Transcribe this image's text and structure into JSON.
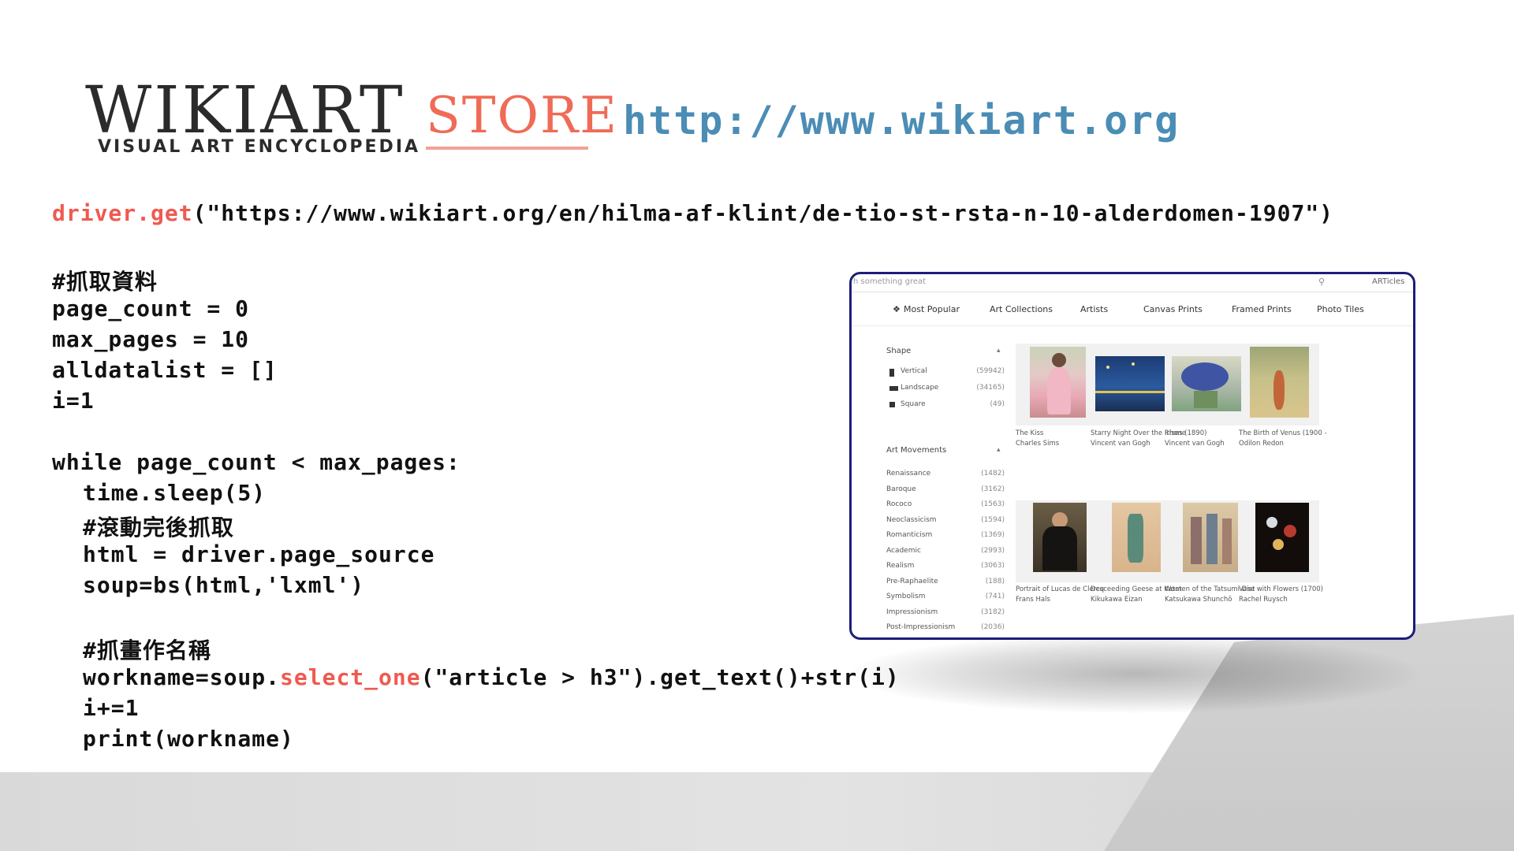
{
  "header": {
    "logo_main": "WIKIART",
    "logo_sub": "VISUAL ART ENCYCLOPEDIA",
    "logo_store": "STORE",
    "url": "http://www.wikiart.org"
  },
  "code": {
    "line1_fn": "driver.get",
    "line1_arg": "(\"https://www.wikiart.org/en/hilma-af-klint/de-tio-st-rsta-n-10-alderdomen-1907\")",
    "c1": "#抓取資料",
    "l2": "page_count = 0",
    "l3": "max_pages = 10",
    "l4": "alldatalist = []",
    "l5": "i=1",
    "l6": "while page_count < max_pages:",
    "l7": "time.sleep(5)",
    "c2": "#滾動完後抓取",
    "l8": "html = driver.page_source",
    "l9": "soup=bs(html,'lxml')",
    "c3": "#抓畫作名稱",
    "l10_a": "workname=soup.",
    "l10_fn": "select_one",
    "l10_b": "(\"article > h3\").get_text()+str(i)",
    "l11": "i+=1",
    "l12": "print(workname)"
  },
  "screenshot": {
    "search_placeholder": "h something great",
    "articles": "ARTicles",
    "nav": {
      "most_popular": "Most Popular",
      "art_collections": "Art Collections",
      "artists": "Artists",
      "canvas_prints": "Canvas Prints",
      "framed_prints": "Framed Prints",
      "photo_tiles": "Photo Tiles"
    },
    "shape_title": "Shape",
    "shape": [
      {
        "label": "Vertical",
        "count": "(59942)"
      },
      {
        "label": "Landscape",
        "count": "(34165)"
      },
      {
        "label": "Square",
        "count": "(49)"
      }
    ],
    "movements_title": "Art Movements",
    "movements": [
      {
        "label": "Renaissance",
        "count": "(1482)"
      },
      {
        "label": "Baroque",
        "count": "(3162)"
      },
      {
        "label": "Rococo",
        "count": "(1563)"
      },
      {
        "label": "Neoclassicism",
        "count": "(1594)"
      },
      {
        "label": "Romanticism",
        "count": "(1369)"
      },
      {
        "label": "Academic",
        "count": "(2993)"
      },
      {
        "label": "Realism",
        "count": "(3063)"
      },
      {
        "label": "Pre-Raphaelite",
        "count": "(188)"
      },
      {
        "label": "Symbolism",
        "count": "(741)"
      },
      {
        "label": "Impressionism",
        "count": "(3182)"
      },
      {
        "label": "Post-Impressionism",
        "count": "(2036)"
      }
    ],
    "artworks": [
      {
        "title": "The Kiss",
        "artist": "Charles Sims"
      },
      {
        "title": "Starry Night Over the Rhone",
        "artist": "Vincent van Gogh"
      },
      {
        "title": "Irises (1890)",
        "artist": "Vincent van Gogh"
      },
      {
        "title": "The Birth of Venus (1900 -",
        "artist": "Odilon Redon"
      },
      {
        "title": "Portrait of Lucas de Clercq",
        "artist": "Frans Hals"
      },
      {
        "title": "Desceeding Geese at Katat",
        "artist": "Kikukawa Eizan"
      },
      {
        "title": "Women of the Tatsumi Dist",
        "artist": "Katsukawa Shunchō"
      },
      {
        "title": "Vase with Flowers (1700)",
        "artist": "Rachel Ruysch"
      }
    ]
  }
}
